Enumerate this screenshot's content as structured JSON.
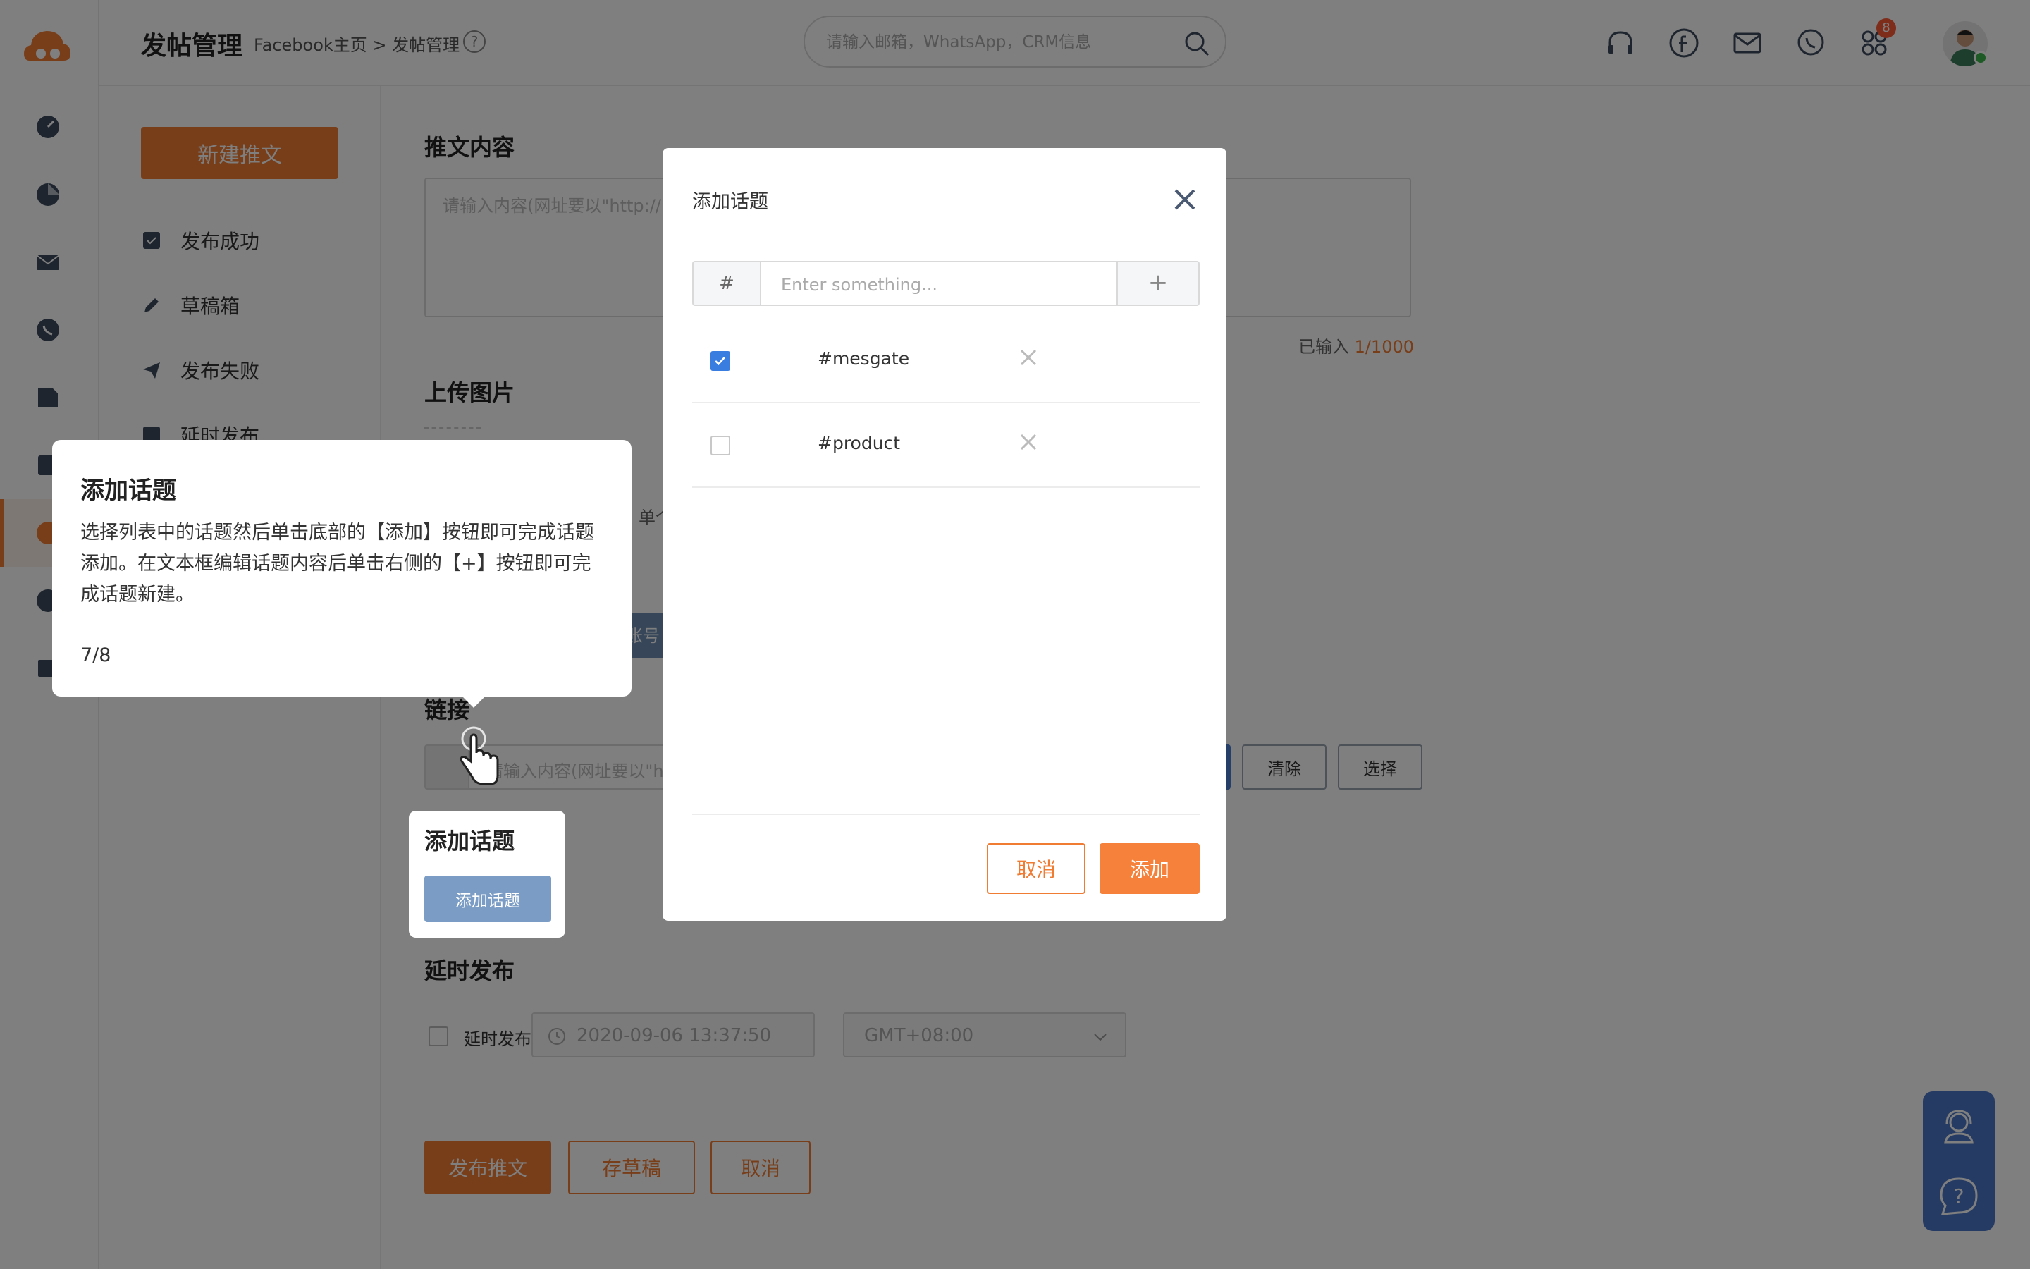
{
  "header": {
    "title": "发帖管理",
    "breadcrumb": "Facebook主页 > 发帖管理",
    "search_placeholder": "请输入邮箱，WhatsApp，CRM信息",
    "notification_count": "8",
    "icons": [
      "headset-icon",
      "facebook-icon",
      "mail-icon",
      "whatsapp-icon",
      "apps-icon"
    ]
  },
  "sidebar": {
    "new_post_label": "新建推文",
    "items": [
      {
        "label": "发布成功",
        "icon": "check-doc-icon"
      },
      {
        "label": "草稿箱",
        "icon": "pencil-icon"
      },
      {
        "label": "发布失败",
        "icon": "paper-plane-icon"
      },
      {
        "label": "延时发布",
        "icon": "clock-doc-icon"
      }
    ]
  },
  "form": {
    "content_label": "推文内容",
    "content_placeholder": "请输入内容(网址要以\"http://\"",
    "counter_prefix": "已输入",
    "counter_value": "1/1000",
    "upload_label": "上传图片",
    "single_text": "单个",
    "gray_block_text": "账号",
    "link_label": "链接",
    "link_placeholder": "请输入内容(网址要以\"ht",
    "clear_label": "清除",
    "select_label": "选择",
    "topic_label": "添加话题",
    "topic_button": "添加话题",
    "delay_section_label": "延时发布",
    "delay_checkbox_label": "延时发布",
    "delay_date": "2020-09-06 13:37:50",
    "timezone": "GMT+08:00",
    "publish_label": "发布推文",
    "save_draft_label": "存草稿",
    "cancel_label": "取消"
  },
  "tooltip": {
    "title": "添加话题",
    "body": "选择列表中的话题然后单击底部的【添加】按钮即可完成话题添加。在文本框编辑话题内容后单击右侧的【+】按钮即可完成话题新建。",
    "step": "7/8"
  },
  "modal": {
    "title": "添加话题",
    "prefix": "#",
    "input_placeholder": "Enter something...",
    "add_symbol": "+",
    "topics": [
      {
        "tag": "#mesgate",
        "checked": true
      },
      {
        "tag": "#product",
        "checked": false
      }
    ],
    "cancel_label": "取消",
    "add_label": "添加"
  },
  "colors": {
    "accent": "#f07c34",
    "checkbox": "#3a7de0",
    "support_widget": "#4a77c9"
  }
}
